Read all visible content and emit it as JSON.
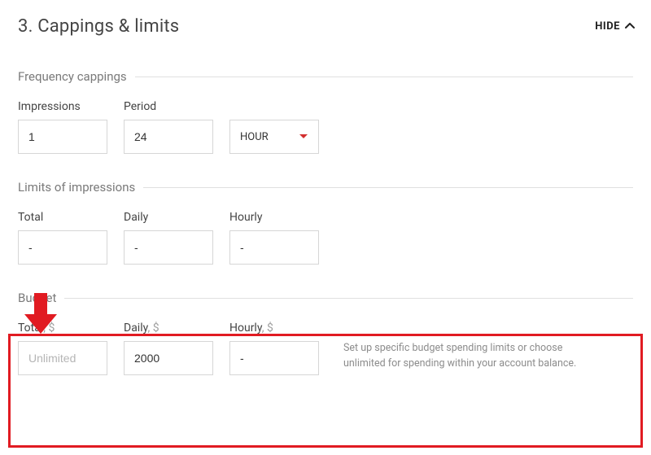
{
  "section": {
    "title": "3. Cappings & limits",
    "toggleLabel": "HIDE"
  },
  "frequency": {
    "heading": "Frequency cappings",
    "impressionsLabel": "Impressions",
    "impressionsValue": "1",
    "periodLabel": "Period",
    "periodValue": "24",
    "periodUnit": "HOUR"
  },
  "limits": {
    "heading": "Limits of impressions",
    "totalLabel": "Total",
    "totalValue": "-",
    "dailyLabel": "Daily",
    "dailyValue": "-",
    "hourlyLabel": "Hourly",
    "hourlyValue": "-"
  },
  "budget": {
    "heading": "Budget",
    "totalLabel": "Total",
    "totalUnit": ", $",
    "totalPlaceholder": "Unlimited",
    "totalValue": "",
    "dailyLabel": "Daily",
    "dailyUnit": ", $",
    "dailyValue": "2000",
    "hourlyLabel": "Hourly",
    "hourlyUnit": ", $",
    "hourlyValue": "-",
    "helper": "Set up specific budget spending limits or choose unlimited for spending within your account balance."
  }
}
